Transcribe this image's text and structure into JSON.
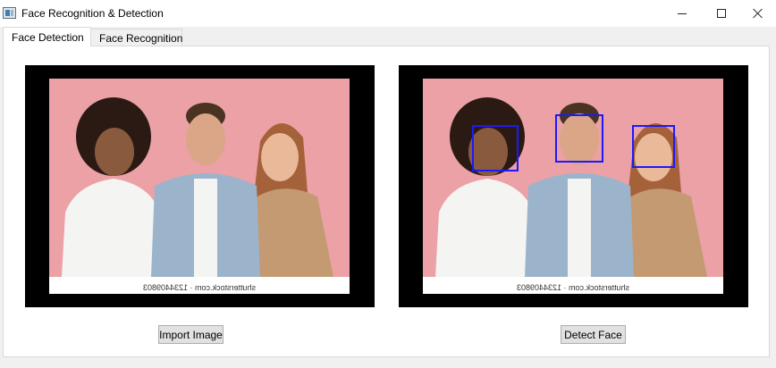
{
  "window": {
    "title": "Face Recognition & Detection"
  },
  "tabs": [
    {
      "label": "Face Detection",
      "active": true
    },
    {
      "label": "Face Recognition",
      "active": false
    }
  ],
  "images": {
    "left": {
      "watermark": "shutterstock.com · 1234409803",
      "description": "input photo"
    },
    "right": {
      "watermark": "shutterstock.com · 1234409803",
      "detected_faces": 3
    }
  },
  "buttons": {
    "import": "Import Image",
    "detect": "Detect Face"
  },
  "colors": {
    "photo_background": "#eba1a6",
    "detection_box": "#1a1aff",
    "frame": "#000000"
  }
}
